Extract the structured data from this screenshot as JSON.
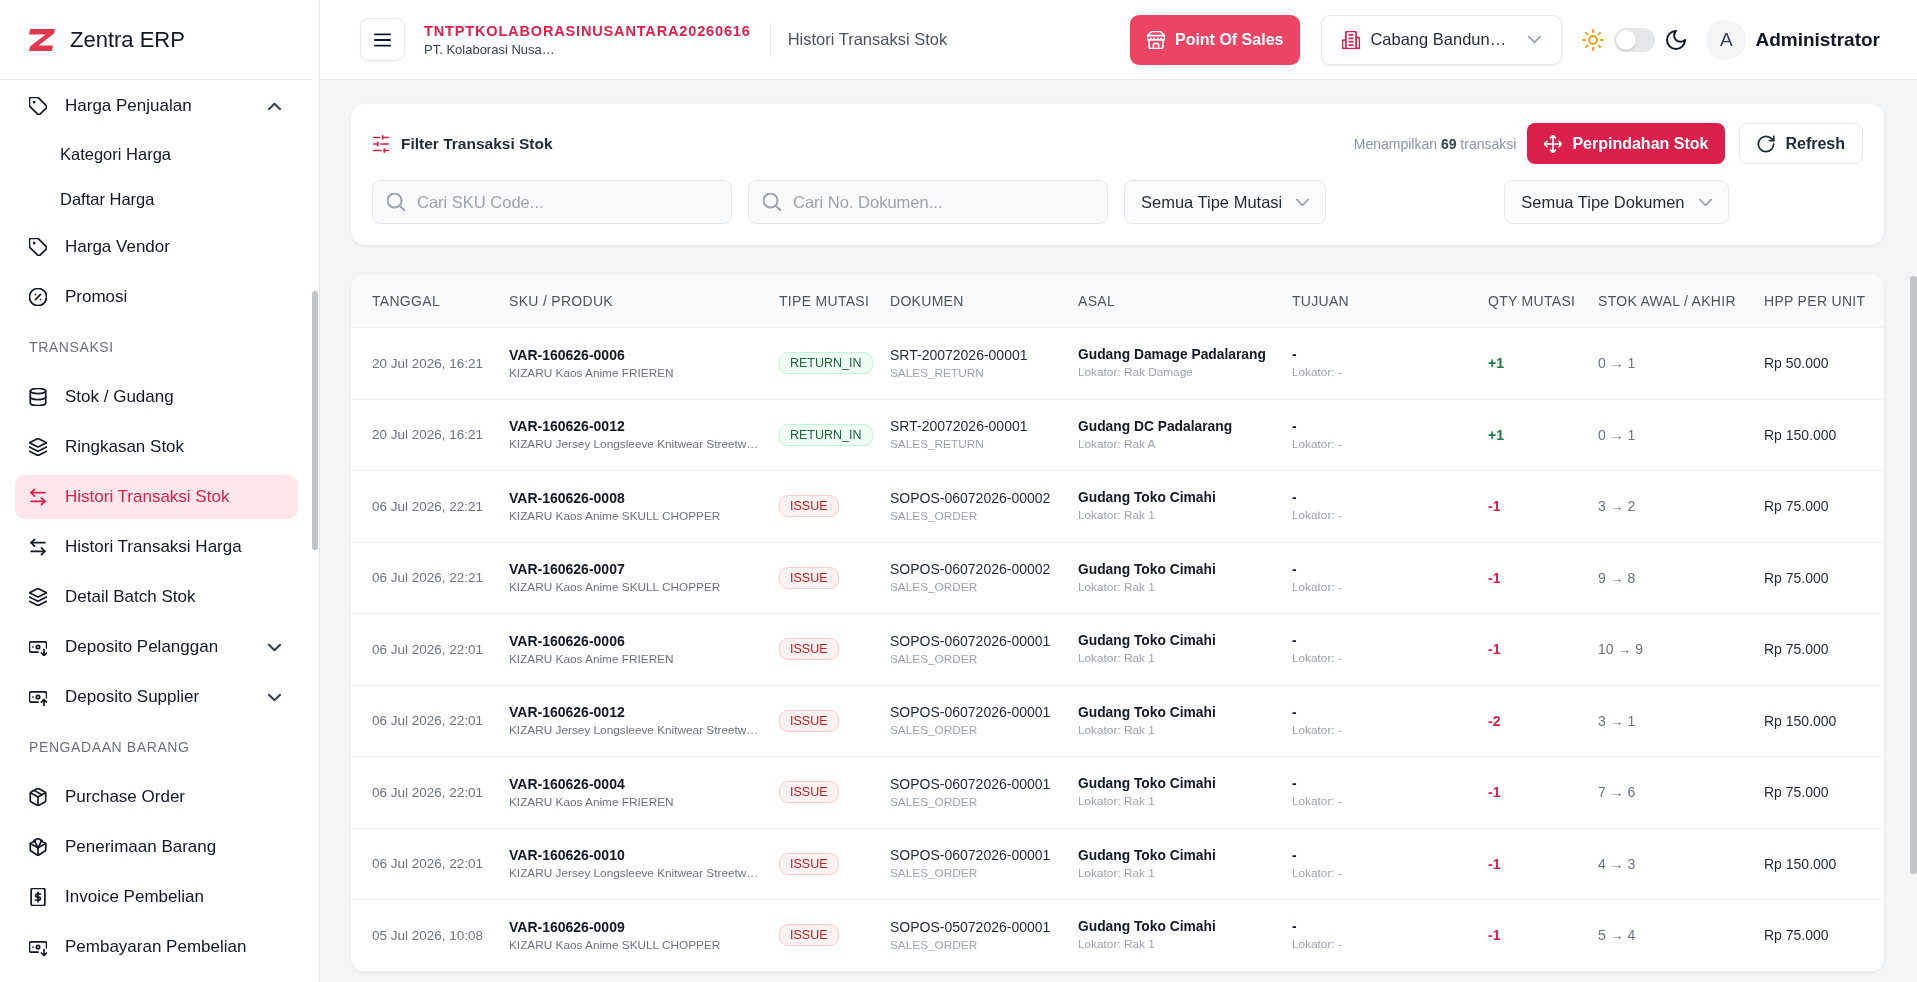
{
  "sidebar": {
    "brand": "Zentra ERP",
    "sections": [
      {
        "items": [
          {
            "label": "Harga Penjualan",
            "selected": false,
            "expanded": true,
            "children": [
              {
                "label": "Kategori Harga",
                "selected": false
              },
              {
                "label": "Daftar Harga",
                "selected": false
              }
            ]
          },
          {
            "label": "Harga Vendor",
            "selected": false
          },
          {
            "label": "Promosi",
            "selected": false
          }
        ]
      },
      {
        "heading": "TRANSAKSI",
        "items": [
          {
            "label": "Stok / Gudang",
            "selected": false
          },
          {
            "label": "Ringkasan Stok",
            "selected": false
          },
          {
            "label": "Histori Transaksi Stok",
            "selected": true
          },
          {
            "label": "Histori Transaksi Harga",
            "selected": false
          },
          {
            "label": "Detail Batch Stok",
            "selected": false
          },
          {
            "label": "Deposito Pelanggan",
            "selected": false,
            "expanded": false
          },
          {
            "label": "Deposito Supplier",
            "selected": false,
            "expanded": false
          }
        ]
      },
      {
        "heading": "PENGADAAN BARANG",
        "items": [
          {
            "label": "Purchase Order",
            "selected": false
          },
          {
            "label": "Penerimaan Barang",
            "selected": false
          },
          {
            "label": "Invoice Pembelian",
            "selected": false
          },
          {
            "label": "Pembayaran Pembelian",
            "selected": false
          }
        ]
      }
    ]
  },
  "header": {
    "company_code": "TNTPTKOLABORASINUSANTARA20260616",
    "company_name": "PT. Kolaborasi Nusa…",
    "page_title": "Histori Transaksi Stok",
    "pos_button": "Point Of Sales",
    "branch": "Cabang Bandun…",
    "dark_mode": false,
    "user": {
      "initial": "A",
      "name": "Administrator"
    }
  },
  "filter": {
    "title": "Filter Transaksi Stok",
    "count_text": "Menampilkan **69** transaksi",
    "buttons": [
      {
        "label": "Perpindahan Stok",
        "kind": "primary"
      },
      {
        "label": "Refresh",
        "kind": "secondary"
      }
    ],
    "fields": [
      {
        "kind": "search",
        "placeholder": "Cari SKU Code..."
      },
      {
        "kind": "search",
        "placeholder": "Cari No. Dokumen..."
      },
      {
        "kind": "select",
        "value": "Semua Tipe Mutasi"
      },
      {
        "kind": "select",
        "value": "Semua Tipe Dokumen"
      }
    ]
  },
  "table": {
    "columns": [
      "TANGGAL",
      "SKU / PRODUK",
      "TIPE MUTASI",
      "DOKUMEN",
      "ASAL",
      "TUJUAN",
      "QTY MUTASI",
      "STOK AWAL / AKHIR",
      "HPP PER UNIT"
    ],
    "rows": [
      {
        "date": "20 Jul 2026, 16:21",
        "sku": "VAR-160626-0006",
        "product": "KIZARU Kaos Anime FRIEREN",
        "mutation_type": "RETURN_IN",
        "kind": "in",
        "document": "SRT-20072026-00001",
        "document_type": "SALES_RETURN",
        "origin": "Gudang Damage Padalarang",
        "origin_locator": "Lokator: Rak Damage",
        "destination": "-",
        "destination_locator": "Lokator: -",
        "qty": "+1",
        "stock": "0 → 1",
        "unit_cost": "Rp 50.000"
      },
      {
        "date": "20 Jul 2026, 16:21",
        "sku": "VAR-160626-0012",
        "product": "KIZARU Jersey Longsleeve Knitwear Streetw…",
        "mutation_type": "RETURN_IN",
        "kind": "in",
        "document": "SRT-20072026-00001",
        "document_type": "SALES_RETURN",
        "origin": "Gudang DC Padalarang",
        "origin_locator": "Lokator: Rak A",
        "destination": "-",
        "destination_locator": "Lokator: -",
        "qty": "+1",
        "stock": "0 → 1",
        "unit_cost": "Rp 150.000"
      },
      {
        "date": "06 Jul 2026, 22:21",
        "sku": "VAR-160626-0008",
        "product": "KIZARU Kaos Anime SKULL CHOPPER",
        "mutation_type": "ISSUE",
        "kind": "out",
        "document": "SOPOS-06072026-00002",
        "document_type": "SALES_ORDER",
        "origin": "Gudang Toko Cimahi",
        "origin_locator": "Lokator: Rak 1",
        "destination": "-",
        "destination_locator": "Lokator: -",
        "qty": "-1",
        "stock": "3 → 2",
        "unit_cost": "Rp 75.000"
      },
      {
        "date": "06 Jul 2026, 22:21",
        "sku": "VAR-160626-0007",
        "product": "KIZARU Kaos Anime SKULL CHOPPER",
        "mutation_type": "ISSUE",
        "kind": "out",
        "document": "SOPOS-06072026-00002",
        "document_type": "SALES_ORDER",
        "origin": "Gudang Toko Cimahi",
        "origin_locator": "Lokator: Rak 1",
        "destination": "-",
        "destination_locator": "Lokator: -",
        "qty": "-1",
        "stock": "9 → 8",
        "unit_cost": "Rp 75.000"
      },
      {
        "date": "06 Jul 2026, 22:01",
        "sku": "VAR-160626-0006",
        "product": "KIZARU Kaos Anime FRIEREN",
        "mutation_type": "ISSUE",
        "kind": "out",
        "document": "SOPOS-06072026-00001",
        "document_type": "SALES_ORDER",
        "origin": "Gudang Toko Cimahi",
        "origin_locator": "Lokator: Rak 1",
        "destination": "-",
        "destination_locator": "Lokator: -",
        "qty": "-1",
        "stock": "10 → 9",
        "unit_cost": "Rp 75.000"
      },
      {
        "date": "06 Jul 2026, 22:01",
        "sku": "VAR-160626-0012",
        "product": "KIZARU Jersey Longsleeve Knitwear Streetw…",
        "mutation_type": "ISSUE",
        "kind": "out",
        "document": "SOPOS-06072026-00001",
        "document_type": "SALES_ORDER",
        "origin": "Gudang Toko Cimahi",
        "origin_locator": "Lokator: Rak 1",
        "destination": "-",
        "destination_locator": "Lokator: -",
        "qty": "-2",
        "stock": "3 → 1",
        "unit_cost": "Rp 150.000"
      },
      {
        "date": "06 Jul 2026, 22:01",
        "sku": "VAR-160626-0004",
        "product": "KIZARU Kaos Anime FRIEREN",
        "mutation_type": "ISSUE",
        "kind": "out",
        "document": "SOPOS-06072026-00001",
        "document_type": "SALES_ORDER",
        "origin": "Gudang Toko Cimahi",
        "origin_locator": "Lokator: Rak 1",
        "destination": "-",
        "destination_locator": "Lokator: -",
        "qty": "-1",
        "stock": "7 → 6",
        "unit_cost": "Rp 75.000"
      },
      {
        "date": "06 Jul 2026, 22:01",
        "sku": "VAR-160626-0010",
        "product": "KIZARU Jersey Longsleeve Knitwear Streetw…",
        "mutation_type": "ISSUE",
        "kind": "out",
        "document": "SOPOS-06072026-00001",
        "document_type": "SALES_ORDER",
        "origin": "Gudang Toko Cimahi",
        "origin_locator": "Lokator: Rak 1",
        "destination": "-",
        "destination_locator": "Lokator: -",
        "qty": "-1",
        "stock": "4 → 3",
        "unit_cost": "Rp 150.000"
      },
      {
        "date": "05 Jul 2026, 10:08",
        "sku": "VAR-160626-0009",
        "product": "KIZARU Kaos Anime SKULL CHOPPER",
        "mutation_type": "ISSUE",
        "kind": "out",
        "document": "SOPOS-05072026-00001",
        "document_type": "SALES_ORDER",
        "origin": "Gudang Toko Cimahi",
        "origin_locator": "Lokator: Rak 1",
        "destination": "-",
        "destination_locator": "Lokator: -",
        "qty": "-1",
        "stock": "5 → 4",
        "unit_cost": "Rp 75.000"
      }
    ]
  }
}
